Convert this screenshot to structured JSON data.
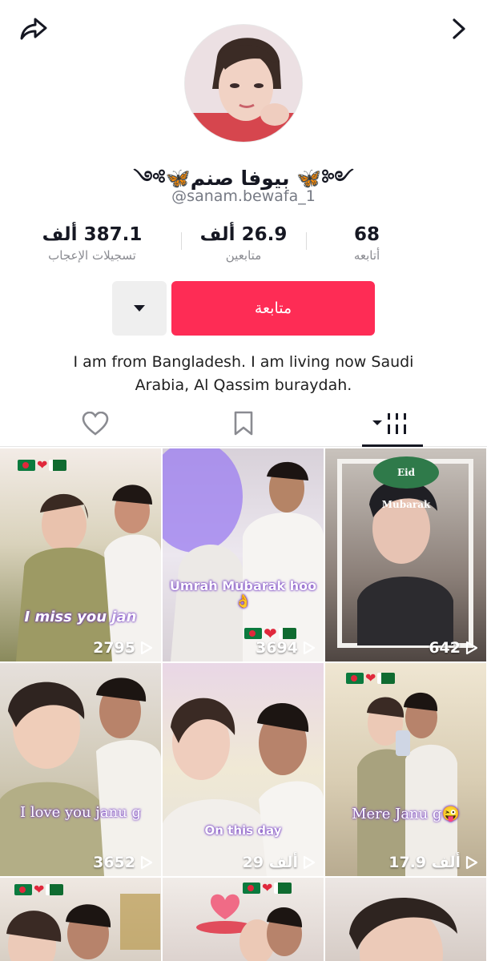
{
  "profile": {
    "display_name": "༺🦋 بيوفا صنم🦋༻",
    "username": "@sanam.bewafa_1",
    "bio": "I am from Bangladesh. I am living now Saudi Arabia, Al Qassim buraydah."
  },
  "stats": {
    "likes": {
      "value": "387.1 ألف",
      "label": "تسجيلات الإعجاب"
    },
    "followers": {
      "value": "26.9 ألف",
      "label": "متابعين"
    },
    "following": {
      "value": "68",
      "label": "أتابعه"
    }
  },
  "actions": {
    "follow_label": "متابعة"
  },
  "colors": {
    "accent": "#fe2c55",
    "text": "#161823",
    "muted": "#8a8b91"
  },
  "icons": {
    "share": "share-arrow-icon",
    "forward": "chevron-right-icon",
    "more": "caret-down-icon",
    "liked_tab": "heart-outline-icon",
    "saved_tab": "bookmark-outline-icon",
    "videos_tab": "grid-bars-icon"
  },
  "videos": [
    {
      "views": "2795",
      "caption": "I miss you jan"
    },
    {
      "views": "3694",
      "caption": "Umrah Mubarak hoo👌"
    },
    {
      "views": "642",
      "caption": "",
      "badge": "Eid Mubarak"
    },
    {
      "views": "3652",
      "caption": "I love you janu g"
    },
    {
      "views": "29 ألف",
      "caption": "On this day"
    },
    {
      "views": "17.9 ألف",
      "caption": "Mere Janu g😜"
    }
  ]
}
